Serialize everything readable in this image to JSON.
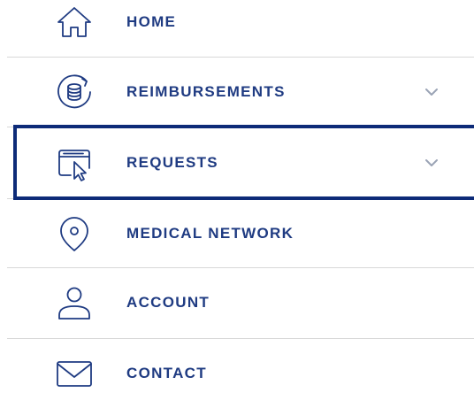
{
  "nav": {
    "items": [
      {
        "label": "HOME",
        "icon": "home-icon",
        "expandable": false
      },
      {
        "label": "REIMBURSEMENTS",
        "icon": "coins-refresh-icon",
        "expandable": true
      },
      {
        "label": "REQUESTS",
        "icon": "window-cursor-icon",
        "expandable": true,
        "selected": true
      },
      {
        "label": "MEDICAL NETWORK",
        "icon": "location-pin-icon",
        "expandable": false
      },
      {
        "label": "ACCOUNT",
        "icon": "user-icon",
        "expandable": false
      },
      {
        "label": "CONTACT",
        "icon": "envelope-icon",
        "expandable": false
      }
    ]
  },
  "colors": {
    "text": "#1f3b82",
    "icon": "#1f3b82",
    "chevron": "#9aa3b5",
    "divider": "#d8d8d8",
    "selection_border": "#0d2b78"
  }
}
